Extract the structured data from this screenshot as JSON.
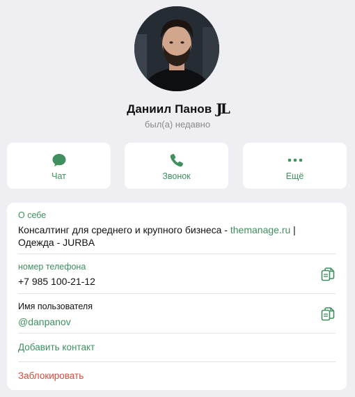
{
  "profile": {
    "name": "Даниил Панов",
    "badge": "JL",
    "status": "был(а) недавно"
  },
  "actions": [
    {
      "label": "Чат",
      "icon": "chat-bubble-icon"
    },
    {
      "label": "Звонок",
      "icon": "phone-icon"
    },
    {
      "label": "Ещё",
      "icon": "more-dots-icon"
    }
  ],
  "info": {
    "about_label": "О себе",
    "about_text_prefix": "Консалтинг для среднего и крупного бизнеса - ",
    "about_link": "themanage.ru",
    "about_text_suffix": " |",
    "about_line2": "Одежда - JURBA",
    "phone_label": "номер телефона",
    "phone_value": "+7 985 100-21-12",
    "username_label": "Имя пользователя",
    "username_value": "@danpanov",
    "add_contact": "Добавить контакт",
    "block": "Заблокировать"
  },
  "colors": {
    "accent": "#3f8f5f",
    "danger": "#d84a3a",
    "background": "#eeeef3"
  }
}
